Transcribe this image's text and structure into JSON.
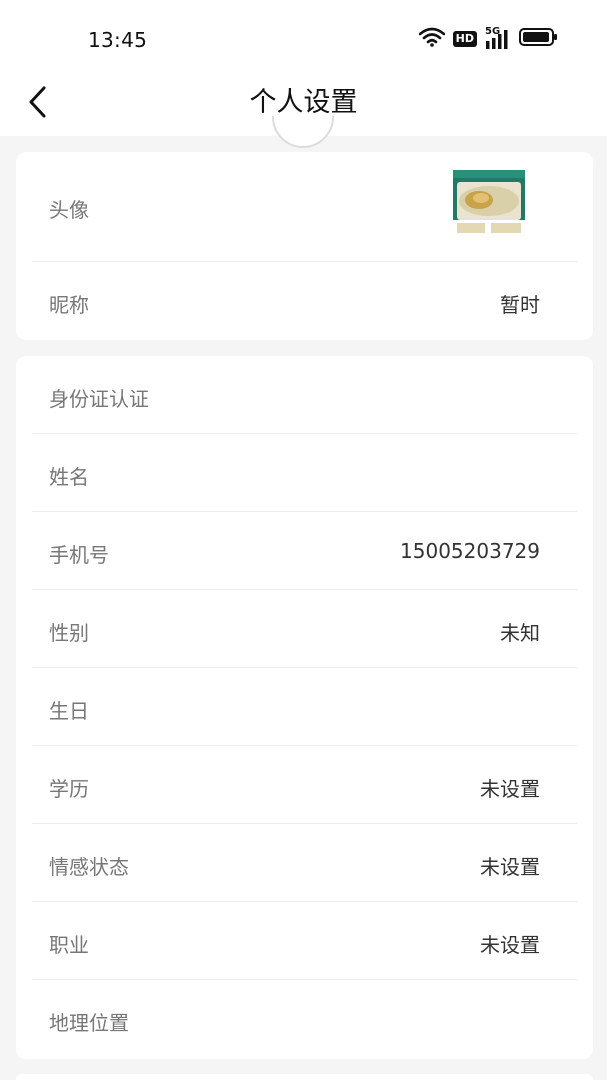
{
  "status_bar": {
    "time": "13:45",
    "icons": [
      "wifi-icon",
      "hd-icon",
      "signal-5g-icon",
      "battery-icon"
    ],
    "hd_label": "HD",
    "network_label": "5G"
  },
  "header": {
    "title": "个人设置",
    "back_icon": "chevron-left-icon"
  },
  "profile_card": {
    "avatar_label": "头像",
    "nickname_label": "昵称",
    "nickname_value": "暂时"
  },
  "info_card": {
    "rows": [
      {
        "label": "身份证认证",
        "value": ""
      },
      {
        "label": "姓名",
        "value": ""
      },
      {
        "label": "手机号",
        "value": "15005203729"
      },
      {
        "label": "性别",
        "value": "未知"
      },
      {
        "label": "生日",
        "value": ""
      },
      {
        "label": "学历",
        "value": "未设置"
      },
      {
        "label": "情感状态",
        "value": "未设置"
      },
      {
        "label": "职业",
        "value": "未设置"
      },
      {
        "label": "地理位置",
        "value": ""
      }
    ]
  },
  "colors": {
    "background": "#f5f5f5",
    "card": "#ffffff",
    "label": "#777777",
    "value": "#333333",
    "divider": "#ececec"
  }
}
